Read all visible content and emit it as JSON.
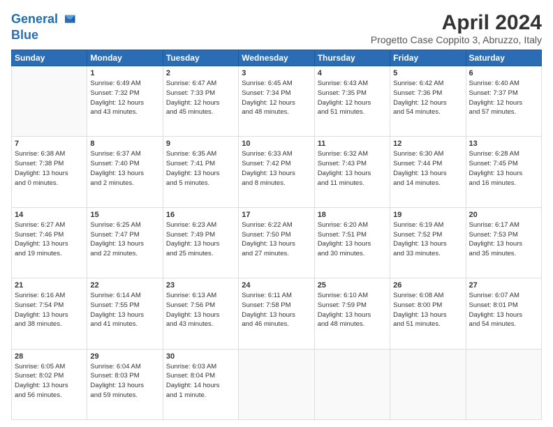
{
  "header": {
    "logo_line1": "General",
    "logo_line2": "Blue",
    "main_title": "April 2024",
    "subtitle": "Progetto Case Coppito 3, Abruzzo, Italy"
  },
  "calendar": {
    "days_of_week": [
      "Sunday",
      "Monday",
      "Tuesday",
      "Wednesday",
      "Thursday",
      "Friday",
      "Saturday"
    ],
    "weeks": [
      [
        {
          "day": "",
          "info": ""
        },
        {
          "day": "1",
          "info": "Sunrise: 6:49 AM\nSunset: 7:32 PM\nDaylight: 12 hours\nand 43 minutes."
        },
        {
          "day": "2",
          "info": "Sunrise: 6:47 AM\nSunset: 7:33 PM\nDaylight: 12 hours\nand 45 minutes."
        },
        {
          "day": "3",
          "info": "Sunrise: 6:45 AM\nSunset: 7:34 PM\nDaylight: 12 hours\nand 48 minutes."
        },
        {
          "day": "4",
          "info": "Sunrise: 6:43 AM\nSunset: 7:35 PM\nDaylight: 12 hours\nand 51 minutes."
        },
        {
          "day": "5",
          "info": "Sunrise: 6:42 AM\nSunset: 7:36 PM\nDaylight: 12 hours\nand 54 minutes."
        },
        {
          "day": "6",
          "info": "Sunrise: 6:40 AM\nSunset: 7:37 PM\nDaylight: 12 hours\nand 57 minutes."
        }
      ],
      [
        {
          "day": "7",
          "info": "Sunrise: 6:38 AM\nSunset: 7:38 PM\nDaylight: 13 hours\nand 0 minutes."
        },
        {
          "day": "8",
          "info": "Sunrise: 6:37 AM\nSunset: 7:40 PM\nDaylight: 13 hours\nand 2 minutes."
        },
        {
          "day": "9",
          "info": "Sunrise: 6:35 AM\nSunset: 7:41 PM\nDaylight: 13 hours\nand 5 minutes."
        },
        {
          "day": "10",
          "info": "Sunrise: 6:33 AM\nSunset: 7:42 PM\nDaylight: 13 hours\nand 8 minutes."
        },
        {
          "day": "11",
          "info": "Sunrise: 6:32 AM\nSunset: 7:43 PM\nDaylight: 13 hours\nand 11 minutes."
        },
        {
          "day": "12",
          "info": "Sunrise: 6:30 AM\nSunset: 7:44 PM\nDaylight: 13 hours\nand 14 minutes."
        },
        {
          "day": "13",
          "info": "Sunrise: 6:28 AM\nSunset: 7:45 PM\nDaylight: 13 hours\nand 16 minutes."
        }
      ],
      [
        {
          "day": "14",
          "info": "Sunrise: 6:27 AM\nSunset: 7:46 PM\nDaylight: 13 hours\nand 19 minutes."
        },
        {
          "day": "15",
          "info": "Sunrise: 6:25 AM\nSunset: 7:47 PM\nDaylight: 13 hours\nand 22 minutes."
        },
        {
          "day": "16",
          "info": "Sunrise: 6:23 AM\nSunset: 7:49 PM\nDaylight: 13 hours\nand 25 minutes."
        },
        {
          "day": "17",
          "info": "Sunrise: 6:22 AM\nSunset: 7:50 PM\nDaylight: 13 hours\nand 27 minutes."
        },
        {
          "day": "18",
          "info": "Sunrise: 6:20 AM\nSunset: 7:51 PM\nDaylight: 13 hours\nand 30 minutes."
        },
        {
          "day": "19",
          "info": "Sunrise: 6:19 AM\nSunset: 7:52 PM\nDaylight: 13 hours\nand 33 minutes."
        },
        {
          "day": "20",
          "info": "Sunrise: 6:17 AM\nSunset: 7:53 PM\nDaylight: 13 hours\nand 35 minutes."
        }
      ],
      [
        {
          "day": "21",
          "info": "Sunrise: 6:16 AM\nSunset: 7:54 PM\nDaylight: 13 hours\nand 38 minutes."
        },
        {
          "day": "22",
          "info": "Sunrise: 6:14 AM\nSunset: 7:55 PM\nDaylight: 13 hours\nand 41 minutes."
        },
        {
          "day": "23",
          "info": "Sunrise: 6:13 AM\nSunset: 7:56 PM\nDaylight: 13 hours\nand 43 minutes."
        },
        {
          "day": "24",
          "info": "Sunrise: 6:11 AM\nSunset: 7:58 PM\nDaylight: 13 hours\nand 46 minutes."
        },
        {
          "day": "25",
          "info": "Sunrise: 6:10 AM\nSunset: 7:59 PM\nDaylight: 13 hours\nand 48 minutes."
        },
        {
          "day": "26",
          "info": "Sunrise: 6:08 AM\nSunset: 8:00 PM\nDaylight: 13 hours\nand 51 minutes."
        },
        {
          "day": "27",
          "info": "Sunrise: 6:07 AM\nSunset: 8:01 PM\nDaylight: 13 hours\nand 54 minutes."
        }
      ],
      [
        {
          "day": "28",
          "info": "Sunrise: 6:05 AM\nSunset: 8:02 PM\nDaylight: 13 hours\nand 56 minutes."
        },
        {
          "day": "29",
          "info": "Sunrise: 6:04 AM\nSunset: 8:03 PM\nDaylight: 13 hours\nand 59 minutes."
        },
        {
          "day": "30",
          "info": "Sunrise: 6:03 AM\nSunset: 8:04 PM\nDaylight: 14 hours\nand 1 minute."
        },
        {
          "day": "",
          "info": ""
        },
        {
          "day": "",
          "info": ""
        },
        {
          "day": "",
          "info": ""
        },
        {
          "day": "",
          "info": ""
        }
      ]
    ]
  }
}
